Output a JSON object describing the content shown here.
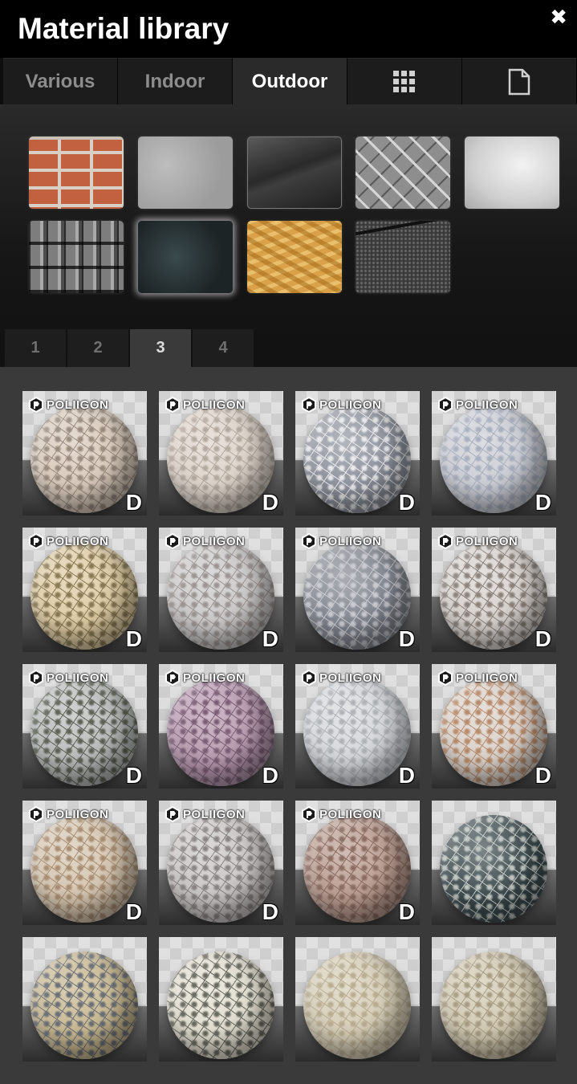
{
  "window": {
    "title": "Material library",
    "close_glyph": "✖"
  },
  "category_tabs": [
    {
      "label": "Various",
      "active": false
    },
    {
      "label": "Indoor",
      "active": false
    },
    {
      "label": "Outdoor",
      "active": true
    },
    {
      "label": "",
      "icon": "grid-icon",
      "active": false
    },
    {
      "label": "",
      "icon": "document-icon",
      "active": false
    }
  ],
  "swatches": [
    {
      "name": "brick",
      "selected": false
    },
    {
      "name": "concrete",
      "selected": false
    },
    {
      "name": "glass",
      "selected": false
    },
    {
      "name": "diamond-plate",
      "selected": false
    },
    {
      "name": "plaster",
      "selected": false
    },
    {
      "name": "roof-tiles",
      "selected": false
    },
    {
      "name": "granite",
      "selected": true
    },
    {
      "name": "osb-wood",
      "selected": false
    },
    {
      "name": "asphalt",
      "selected": false
    }
  ],
  "page_tabs": {
    "pages": [
      "1",
      "2",
      "3",
      "4"
    ],
    "active": "3"
  },
  "materials": {
    "brand_label": "POLIIGON",
    "badge_label": "D",
    "items": [
      {
        "brand": true,
        "badge": true,
        "base": "#d7c8b9",
        "pattern": "#9a8d80"
      },
      {
        "brand": true,
        "badge": true,
        "base": "#dcd2c8",
        "pattern": "#b5aaa0"
      },
      {
        "brand": true,
        "badge": true,
        "base": "#8a8f99",
        "pattern": "#e9e9ec"
      },
      {
        "brand": true,
        "badge": true,
        "base": "#c9ccd3",
        "pattern": "#a9b0be"
      },
      {
        "brand": true,
        "badge": true,
        "base": "#dcc9a0",
        "pattern": "#8a7a55"
      },
      {
        "brand": true,
        "badge": true,
        "base": "#c8c6c6",
        "pattern": "#9c9593"
      },
      {
        "brand": true,
        "badge": true,
        "base": "#7e838c",
        "pattern": "#c9cbd0"
      },
      {
        "brand": true,
        "badge": true,
        "base": "#d6d0cc",
        "pattern": "#8c837c"
      },
      {
        "brand": true,
        "badge": true,
        "base": "#b7b8b8",
        "pattern": "#5f6358"
      },
      {
        "brand": true,
        "badge": true,
        "base": "#b596ac",
        "pattern": "#7d6078"
      },
      {
        "brand": true,
        "badge": true,
        "base": "#d3d6d9",
        "pattern": "#b0b4b8"
      },
      {
        "brand": true,
        "badge": true,
        "base": "#d8cfc8",
        "pattern": "#b88c6c"
      },
      {
        "brand": true,
        "badge": true,
        "base": "#d3c3ad",
        "pattern": "#a88f74"
      },
      {
        "brand": true,
        "badge": true,
        "base": "#c7c3c3",
        "pattern": "#8b8585"
      },
      {
        "brand": true,
        "badge": true,
        "base": "#b89a8e",
        "pattern": "#8c6e63"
      },
      {
        "brand": false,
        "badge": false,
        "base": "#39474a",
        "pattern": "#c2c8c3"
      },
      {
        "brand": false,
        "badge": false,
        "base": "#c5b58c",
        "pattern": "#6c7078"
      },
      {
        "brand": false,
        "badge": false,
        "base": "#e0dccd",
        "pattern": "#6a6c62"
      },
      {
        "brand": false,
        "badge": false,
        "base": "#d4cbb4",
        "pattern": "#b9ad92"
      },
      {
        "brand": false,
        "badge": false,
        "base": "#cfc6ae",
        "pattern": "#a89d84"
      }
    ]
  }
}
